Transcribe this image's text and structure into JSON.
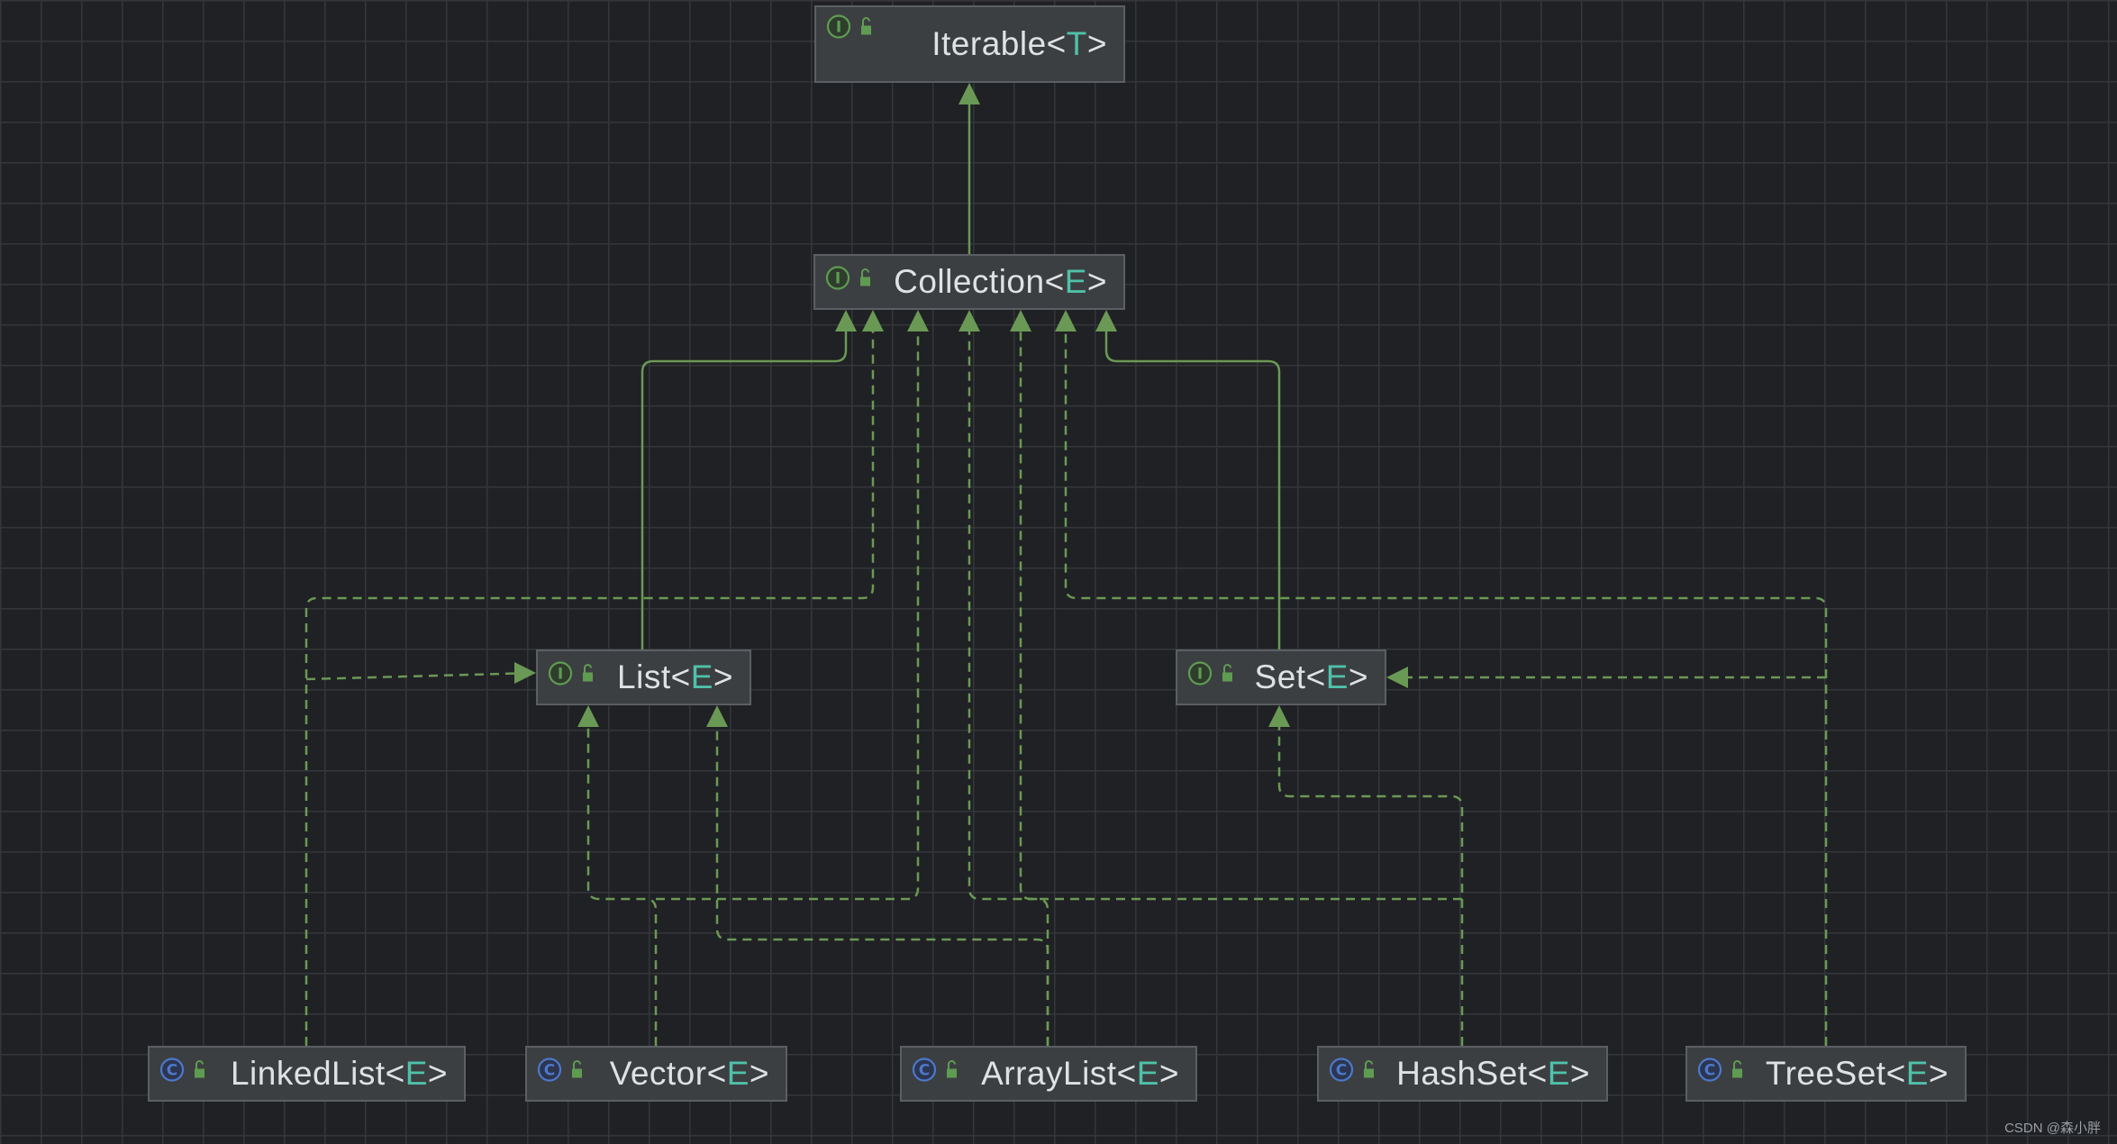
{
  "diagram": {
    "nodes": {
      "iterable": {
        "kind": "interface",
        "name": "Iterable",
        "open": "<",
        "param": "T",
        "close": ">"
      },
      "collection": {
        "kind": "interface",
        "name": "Collection",
        "open": "<",
        "param": "E",
        "close": ">"
      },
      "list": {
        "kind": "interface",
        "name": "List",
        "open": "<",
        "param": "E",
        "close": ">"
      },
      "set": {
        "kind": "interface",
        "name": "Set",
        "open": "<",
        "param": "E",
        "close": ">"
      },
      "linkedlist": {
        "kind": "class",
        "name": "LinkedList",
        "open": "<",
        "param": "E",
        "close": ">"
      },
      "vector": {
        "kind": "class",
        "name": "Vector",
        "open": "<",
        "param": "E",
        "close": ">"
      },
      "arraylist": {
        "kind": "class",
        "name": "ArrayList",
        "open": "<",
        "param": "E",
        "close": ">"
      },
      "hashset": {
        "kind": "class",
        "name": "HashSet",
        "open": "<",
        "param": "E",
        "close": ">"
      },
      "treeset": {
        "kind": "class",
        "name": "TreeSet",
        "open": "<",
        "param": "E",
        "close": ">"
      }
    },
    "edges": [
      {
        "from": "collection",
        "to": "iterable",
        "relation": "extends"
      },
      {
        "from": "list",
        "to": "collection",
        "relation": "extends"
      },
      {
        "from": "set",
        "to": "collection",
        "relation": "extends"
      },
      {
        "from": "linkedlist",
        "to": "collection",
        "relation": "implements"
      },
      {
        "from": "linkedlist",
        "to": "list",
        "relation": "implements"
      },
      {
        "from": "vector",
        "to": "collection",
        "relation": "implements"
      },
      {
        "from": "vector",
        "to": "list",
        "relation": "implements"
      },
      {
        "from": "arraylist",
        "to": "collection",
        "relation": "implements"
      },
      {
        "from": "arraylist",
        "to": "list",
        "relation": "implements"
      },
      {
        "from": "hashset",
        "to": "collection",
        "relation": "implements"
      },
      {
        "from": "hashset",
        "to": "set",
        "relation": "implements"
      },
      {
        "from": "treeset",
        "to": "collection",
        "relation": "implements"
      },
      {
        "from": "treeset",
        "to": "set",
        "relation": "implements"
      }
    ]
  },
  "colors": {
    "edge": "#6a9955",
    "interface_icon": "#5f9c52",
    "class_icon": "#4d78cc",
    "type_param": "#4fc1a9",
    "node_bg": "#3c3f41"
  },
  "icons": {
    "interface": "interface-i-icon",
    "class": "class-c-icon",
    "visibility": "public-lock-icon"
  },
  "watermark": "CSDN @森小胖"
}
